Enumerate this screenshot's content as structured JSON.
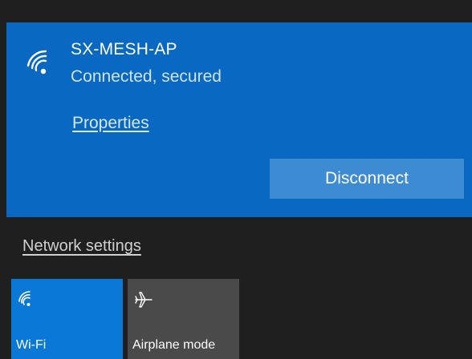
{
  "network": {
    "ssid": "SX-MESH-AP",
    "status": "Connected, secured",
    "properties_label": "Properties",
    "disconnect_label": "Disconnect",
    "icon": "wifi-icon"
  },
  "footer": {
    "network_settings_label": "Network settings"
  },
  "quick_actions": {
    "wifi": {
      "label": "Wi-Fi",
      "icon": "wifi-icon",
      "active": true
    },
    "airplane": {
      "label": "Airplane mode",
      "icon": "airplane-icon",
      "active": false
    }
  },
  "colors": {
    "card_bg": "#0868c2",
    "button_bg": "#3d8bd3",
    "wifi_tile_bg": "#0a78d7",
    "airplane_tile_bg": "#4a4a4a",
    "panel_bg": "#1f1f1f"
  }
}
